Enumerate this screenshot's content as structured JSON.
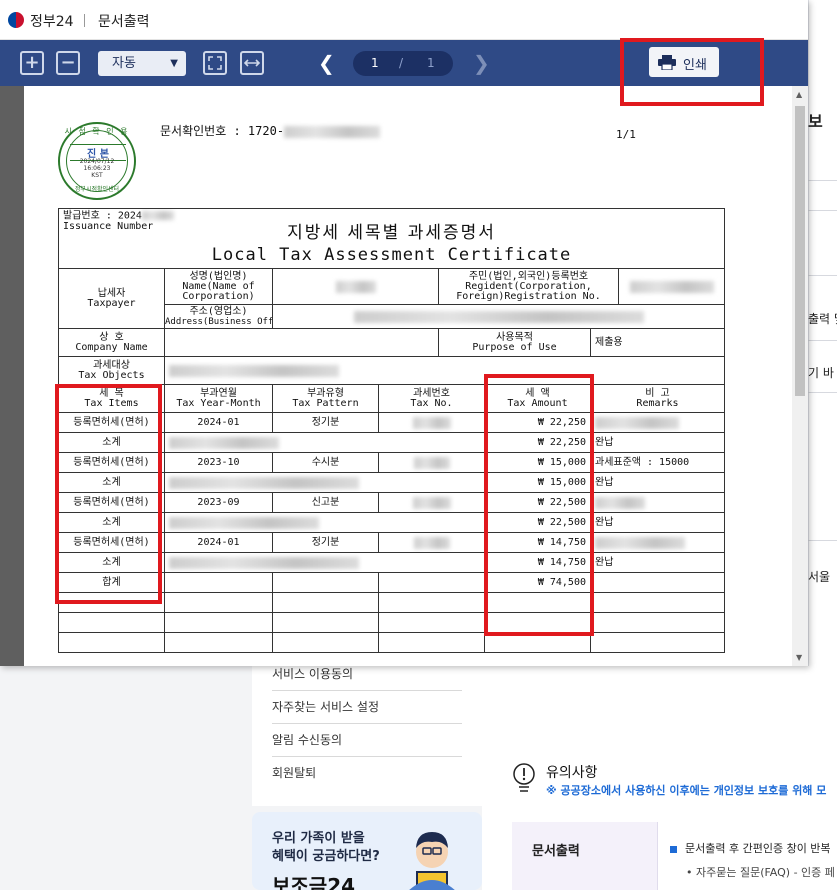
{
  "window": {
    "app_name": "정부24",
    "doc_title": "문서출력"
  },
  "toolbar": {
    "zoom_in": "+",
    "zoom_out": "−",
    "zoom_value": "자동",
    "current_page": "1",
    "page_sep": "/",
    "total_pages": "1",
    "print_label": "인쇄"
  },
  "document": {
    "confirm_label": "문서확인번호 : 1720-",
    "page_of": "1/1",
    "seal": {
      "top": "시 점 확 인 용",
      "mid": "진 본",
      "date": "2024/07/12",
      "time": "16:06:23",
      "tz": "KST",
      "bottom": "정부시점확인센터"
    },
    "issuance_label": "발급번호 : 2024",
    "issuance_en": "Issuance Number",
    "title_ko": "지방세 세목별 과세증명서",
    "title_en": "Local Tax Assessment Certificate",
    "taxpayer": "납세자",
    "taxpayer_en": "Taxpayer",
    "name_label": "성명(법인명)",
    "name_label_en1": "Name(Name of",
    "name_label_en2": "Corporation)",
    "reg_label": "주민(법인,외국인)등록번호",
    "reg_label_en1": "Regident(Corporation,",
    "reg_label_en2": "Foreign)Registration No.",
    "addr_label": "주소(영업소)",
    "addr_label_en": "Address(Business Office)",
    "company_label": "상   호",
    "company_label_en": "Company Name",
    "purpose_label": "사용목적",
    "purpose_label_en": "Purpose of Use",
    "purpose_value": "제출용",
    "objects_label": "과세대상",
    "objects_label_en": "Tax Objects",
    "headers": {
      "items": "세   목",
      "items_en": "Tax Items",
      "year_month": "부과연월",
      "year_month_en": "Tax Year-Month",
      "pattern": "부과유형",
      "pattern_en": "Tax Pattern",
      "tax_no": "과세번호",
      "tax_no_en": "Tax No.",
      "amount": "세   액",
      "amount_en": "Tax Amount",
      "remarks": "비   고",
      "remarks_en": "Remarks"
    },
    "rows": [
      {
        "item": "등록면허세(면허)",
        "ym": "2024-01",
        "pattern": "정기분",
        "amount": "₩ 22,250",
        "remarks": ""
      },
      {
        "item": "소계",
        "ym": "",
        "pattern": "",
        "amount": "₩ 22,250",
        "remarks": "완납"
      },
      {
        "item": "등록면허세(면허)",
        "ym": "2023-10",
        "pattern": "수시분",
        "amount": "₩ 15,000",
        "remarks": "과세표준액 : 15000"
      },
      {
        "item": "소계",
        "ym": "",
        "pattern": "",
        "amount": "₩ 15,000",
        "remarks": "완납"
      },
      {
        "item": "등록면허세(면허)",
        "ym": "2023-09",
        "pattern": "신고분",
        "amount": "₩ 22,500",
        "remarks": ""
      },
      {
        "item": "소계",
        "ym": "",
        "pattern": "",
        "amount": "₩ 22,500",
        "remarks": "완납"
      },
      {
        "item": "등록면허세(면허)",
        "ym": "2024-01",
        "pattern": "정기분",
        "amount": "₩ 14,750",
        "remarks": ""
      },
      {
        "item": "소계",
        "ym": "",
        "pattern": "",
        "amount": "₩ 14,750",
        "remarks": "완납"
      },
      {
        "item": "합계",
        "ym": "",
        "pattern": "",
        "amount": "₩ 74,500",
        "remarks": ""
      }
    ]
  },
  "background": {
    "right_items": [
      "보",
      "출력 및",
      "기 바",
      "서울"
    ],
    "menu": [
      "서비스 이용동의",
      "자주찾는 서비스 설정",
      "알림 수신동의",
      "회원탈퇴"
    ],
    "banner_line1": "우리 가족이 받을",
    "banner_line2": "혜택이 궁금하다면?",
    "banner_big": "보조금24",
    "notice_title": "유의사항",
    "notice_sub": "※ 공공장소에서 사용하신 이후에는 개인정보 보호를 위해 모",
    "doc_box_title": "문서출력",
    "doc_bullet": "문서출력 후 간편인증 창이 반복",
    "doc_bullet2": "• 자주묻는 질문(FAQ) - 인증 페"
  },
  "colors": {
    "toolbar_bg": "#2f4a86",
    "highlight_red": "#e0191e",
    "seal_green": "#2c7a2c"
  },
  "icons": {
    "zoom_in": "plus-box-icon",
    "zoom_out": "minus-box-icon",
    "fit_page": "fit-page-icon",
    "fit_width": "fit-width-icon",
    "prev": "chevron-left-icon",
    "next": "chevron-right-icon",
    "print": "printer-icon",
    "notice": "lightbulb-icon"
  }
}
